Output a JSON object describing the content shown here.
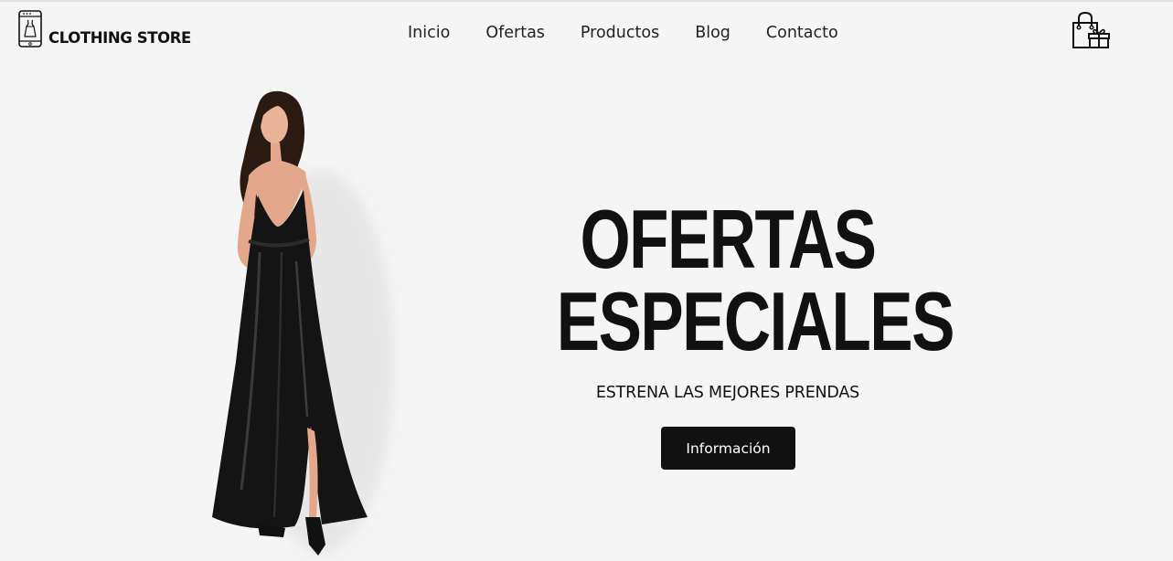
{
  "brand": {
    "name": "CLOTHING STORE",
    "icon": "dress-phone-icon"
  },
  "nav": {
    "items": [
      {
        "label": "Inicio"
      },
      {
        "label": "Ofertas"
      },
      {
        "label": "Productos"
      },
      {
        "label": "Blog"
      },
      {
        "label": "Contacto"
      }
    ]
  },
  "cart": {
    "icon": "shopping-bag-gift-icon"
  },
  "hero": {
    "title_line1": "OFERTAS",
    "title_line2": "ESPECIALES",
    "subtitle": "ESTRENA LAS MEJORES PRENDAS",
    "button_label": "Información"
  },
  "colors": {
    "background": "#f5f5f5",
    "text": "#111111",
    "button_bg": "#111111",
    "button_text": "#ffffff"
  }
}
